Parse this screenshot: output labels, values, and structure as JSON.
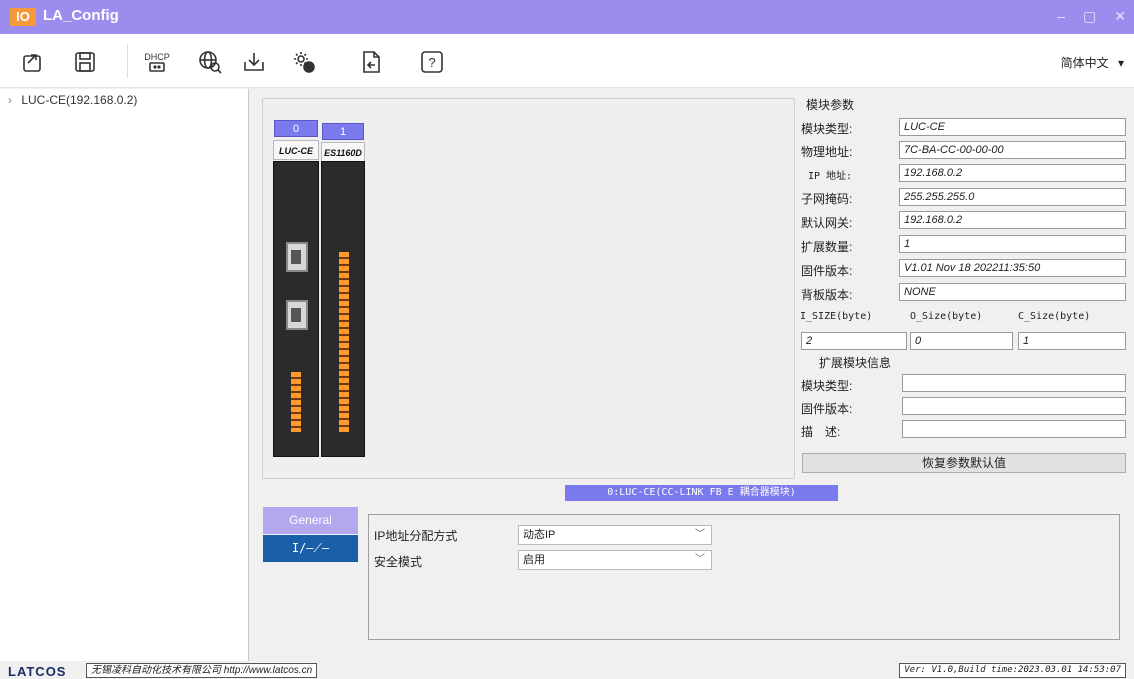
{
  "app": {
    "logo": "IO",
    "title": "LA_Config"
  },
  "window_controls": {
    "minimize": "–",
    "maximize": "▢",
    "close": "✕"
  },
  "toolbar": {
    "dhcp_label": "DHCP",
    "help_label": "?",
    "language": "简体中文"
  },
  "tree": {
    "items": [
      {
        "label": "LUC-CE(192.168.0.2)"
      }
    ]
  },
  "rack": {
    "modules": [
      {
        "slot": "0",
        "name": "LUC-CE"
      },
      {
        "slot": "1",
        "name": "ES1160D"
      }
    ]
  },
  "params": {
    "group_title": "模块参数",
    "rows": [
      {
        "label": "模块类型:",
        "value": "LUC-CE"
      },
      {
        "label": "物理地址:",
        "value": "7C-BA-CC-00-00-00"
      },
      {
        "label": "IP 地址:",
        "value": "192.168.0.2"
      },
      {
        "label": "子网掩码:",
        "value": "255.255.255.0"
      },
      {
        "label": "默认网关:",
        "value": "192.168.0.2"
      },
      {
        "label": "扩展数量:",
        "value": "1"
      },
      {
        "label": "固件版本:",
        "value": "V1.01 Nov 18 202211:35:50"
      },
      {
        "label": "背板版本:",
        "value": "NONE"
      }
    ],
    "size_headers": [
      "I_SIZE(byte)",
      "O_Size(byte)",
      "C_Size(byte)"
    ],
    "size_values": [
      "2",
      "0",
      "1"
    ],
    "ext_group_title": "扩展模块信息",
    "ext_rows": [
      {
        "label": "模块类型:",
        "value": ""
      },
      {
        "label": "固件版本:",
        "value": ""
      },
      {
        "label": "描　述:",
        "value": ""
      }
    ],
    "restore_button": "恢复参数默认值"
  },
  "module_caption": "0:LUC-CE(CC-LINK FB E 耦合器模块)",
  "tabs": [
    {
      "label": "General"
    },
    {
      "label": "I/—⟋—"
    }
  ],
  "settings": [
    {
      "label": "IP地址分配方式",
      "value": "动态IP"
    },
    {
      "label": "安全模式",
      "value": "启用"
    }
  ],
  "footer": {
    "brand": "LATCOS",
    "company": "无锡凌科自动化技术有限公司 http://www.latcos.cn",
    "version": "Ver: V1.0,Build time:2023.03.01 14:53:07"
  }
}
